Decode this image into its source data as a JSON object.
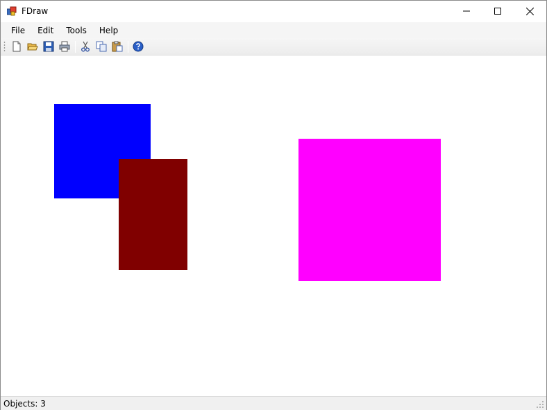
{
  "window": {
    "title": "FDraw"
  },
  "menu": {
    "items": [
      {
        "label": "File"
      },
      {
        "label": "Edit"
      },
      {
        "label": "Tools"
      },
      {
        "label": "Help"
      }
    ]
  },
  "toolbar": {
    "buttons": [
      {
        "icon": "new-document-icon"
      },
      {
        "icon": "open-folder-icon"
      },
      {
        "icon": "save-icon"
      },
      {
        "icon": "print-icon"
      },
      {
        "icon": "cut-icon"
      },
      {
        "icon": "copy-icon"
      },
      {
        "icon": "paste-icon"
      },
      {
        "icon": "help-icon"
      }
    ]
  },
  "canvas": {
    "shapes": [
      {
        "type": "rectangle",
        "color": "#0000ff"
      },
      {
        "type": "rectangle",
        "color": "#800000"
      },
      {
        "type": "rectangle",
        "color": "#ff00ff"
      }
    ]
  },
  "status": {
    "objects_text": "Objects: 3"
  }
}
